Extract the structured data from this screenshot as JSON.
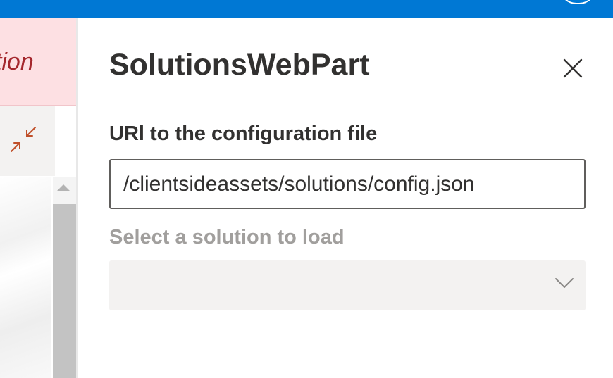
{
  "window": {
    "accent_color": "#0078d4"
  },
  "left_pane": {
    "error_text": "ation",
    "error_color": "#a4262c",
    "collapse_icon": "collapse-arrows-icon"
  },
  "property_pane": {
    "title": "SolutionsWebPart",
    "close_icon": "close-icon",
    "config_field": {
      "label": "URl to the configuration file",
      "value": "/clientsideassets/solutions/config.json"
    },
    "solution_dropdown": {
      "label": "Select a solution to load",
      "selected_value": "",
      "disabled": true,
      "icon": "chevron-down-icon"
    }
  }
}
